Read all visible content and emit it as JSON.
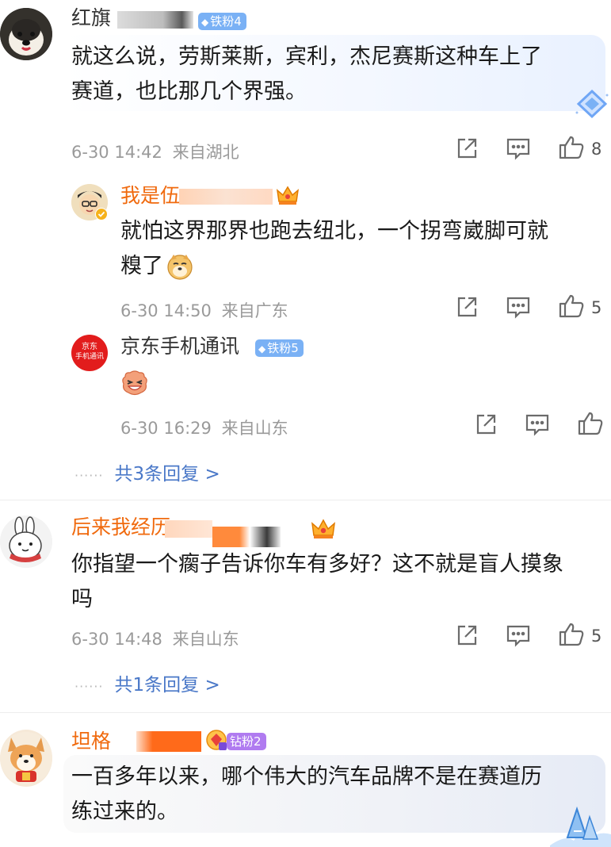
{
  "comments": [
    {
      "username": "红旗",
      "badge": "铁粉4",
      "text_line1": "就这么说，劳斯莱斯，宾利，杰尼赛斯这种车上了",
      "text_line2": "赛道，也比那几个界强。",
      "date": "6-30",
      "time": "14:42",
      "location": "来自湖北",
      "likes": "8",
      "replies": [
        {
          "username": "我是伍",
          "text_line1": "就怕这界那界也跑去纽北，一个拐弯崴脚可就",
          "text_line2": "糗了",
          "date": "6-30",
          "time": "14:50",
          "location": "来自广东",
          "likes": "5"
        },
        {
          "username": "京东手机通讯",
          "avatar_text_top": "京东",
          "avatar_text_bottom": "手机通讯",
          "badge": "铁粉5",
          "date": "6-30",
          "time": "16:29",
          "location": "来自山东",
          "likes": ""
        }
      ],
      "more_dots": "······",
      "more_label": "共3条回复 >"
    },
    {
      "username": "后来我经历",
      "text_line1": "你指望一个瘸子告诉你车有多好？这不就是盲人摸象",
      "text_line2": "吗",
      "date": "6-30",
      "time": "14:48",
      "location": "来自山东",
      "likes": "5",
      "more_dots": "······",
      "more_label": "共1条回复 >"
    },
    {
      "username": "坦格",
      "badge": "钻粉2",
      "text_line1": "一百多年以来，哪个伟大的汽车品牌不是在赛道历",
      "text_line2": "练过来的。"
    }
  ],
  "colors": {
    "username_orange": "#f06a0e",
    "link_blue": "#4a78c8",
    "meta_gray": "#9a9a9a",
    "badge_blue": "#7ab1f5",
    "badge_purple": "#b07bf0",
    "censor_orange": "#ff6a1a"
  },
  "icons": [
    "share-icon",
    "comment-icon",
    "like-icon",
    "diamond-icon",
    "crown-icon",
    "doge-emoji",
    "laugh-emoji"
  ]
}
